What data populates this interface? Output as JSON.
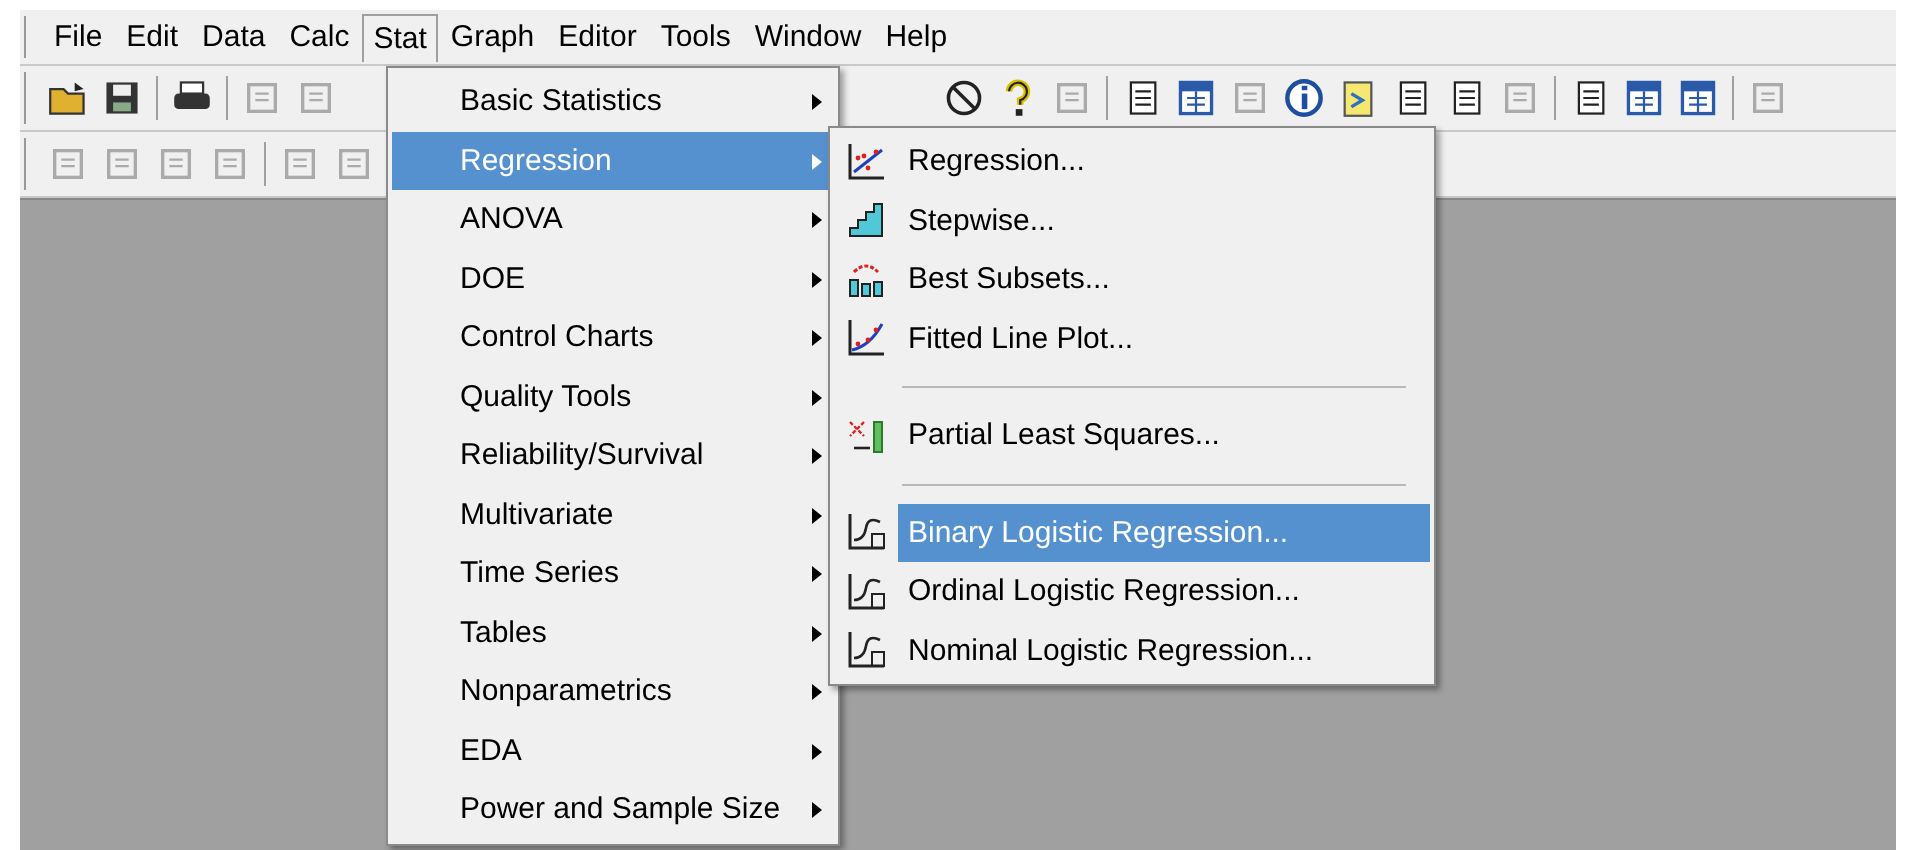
{
  "menubar": [
    {
      "label": "File",
      "selected": false
    },
    {
      "label": "Edit",
      "selected": false
    },
    {
      "label": "Data",
      "selected": false
    },
    {
      "label": "Calc",
      "selected": false
    },
    {
      "label": "Stat",
      "selected": true
    },
    {
      "label": "Graph",
      "selected": false
    },
    {
      "label": "Editor",
      "selected": false
    },
    {
      "label": "Tools",
      "selected": false
    },
    {
      "label": "Window",
      "selected": false
    },
    {
      "label": "Help",
      "selected": false
    }
  ],
  "stat_menu": {
    "items": [
      {
        "label": "Basic Statistics",
        "selected": false,
        "has_submenu": true
      },
      {
        "label": "Regression",
        "selected": true,
        "has_submenu": true
      },
      {
        "label": "ANOVA",
        "selected": false,
        "has_submenu": true
      },
      {
        "label": "DOE",
        "selected": false,
        "has_submenu": true
      },
      {
        "label": "Control Charts",
        "selected": false,
        "has_submenu": true
      },
      {
        "label": "Quality Tools",
        "selected": false,
        "has_submenu": true
      },
      {
        "label": "Reliability/Survival",
        "selected": false,
        "has_submenu": true
      },
      {
        "label": "Multivariate",
        "selected": false,
        "has_submenu": true
      },
      {
        "label": "Time Series",
        "selected": false,
        "has_submenu": true
      },
      {
        "label": "Tables",
        "selected": false,
        "has_submenu": true
      },
      {
        "label": "Nonparametrics",
        "selected": false,
        "has_submenu": true
      },
      {
        "label": "EDA",
        "selected": false,
        "has_submenu": true
      },
      {
        "label": "Power and Sample Size",
        "selected": false,
        "has_submenu": true
      }
    ]
  },
  "regression_submenu": {
    "groups": [
      [
        {
          "label": "Regression...",
          "kind": "scatter",
          "selected": false
        },
        {
          "label": "Stepwise...",
          "kind": "stairs",
          "selected": false
        },
        {
          "label": "Best Subsets...",
          "kind": "subsets",
          "selected": false
        },
        {
          "label": "Fitted Line Plot...",
          "kind": "fitted",
          "selected": false
        }
      ],
      [
        {
          "label": "Partial Least Squares...",
          "kind": "pls",
          "selected": false
        }
      ],
      [
        {
          "label": "Binary Logistic Regression...",
          "kind": "logistic",
          "selected": true
        },
        {
          "label": "Ordinal Logistic Regression...",
          "kind": "logistic",
          "selected": false
        },
        {
          "label": "Nominal Logistic Regression...",
          "kind": "logistic",
          "selected": false
        }
      ]
    ]
  }
}
